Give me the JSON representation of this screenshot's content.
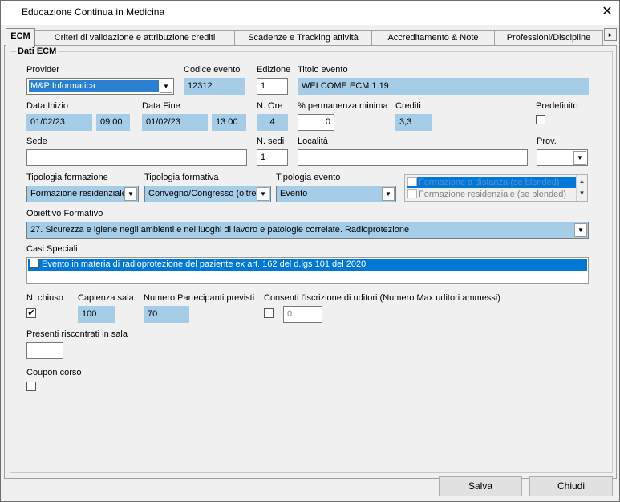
{
  "window": {
    "title": "Educazione Continua in Medicina",
    "close_glyph": "✕"
  },
  "tabs": [
    {
      "label": "ECM"
    },
    {
      "label": "Criteri di validazione e attribuzione crediti"
    },
    {
      "label": "Scadenze e Tracking attività"
    },
    {
      "label": "Accreditamento & Note"
    },
    {
      "label": "Professioni/Discipline"
    }
  ],
  "tab_scroll_glyph": "▸",
  "group": {
    "title": "Dati ECM"
  },
  "form": {
    "provider": {
      "label": "Provider",
      "value": "M&P Informatica"
    },
    "codice_evento": {
      "label": "Codice evento",
      "value": "12312"
    },
    "edizione": {
      "label": "Edizione",
      "value": "1"
    },
    "titolo_evento": {
      "label": "Titolo evento",
      "value": "WELCOME ECM 1.19"
    },
    "data_inizio": {
      "label": "Data Inizio",
      "date": "01/02/23",
      "time": "09:00"
    },
    "data_fine": {
      "label": "Data Fine",
      "date": "01/02/23",
      "time": "13:00"
    },
    "n_ore": {
      "label": "N. Ore",
      "value": "4"
    },
    "permanenza": {
      "label": "% permanenza minima",
      "value": "0"
    },
    "crediti": {
      "label": "Crediti",
      "value": "3,3"
    },
    "predefinito": {
      "label": "Predefinito",
      "checked": false
    },
    "sede": {
      "label": "Sede",
      "value": ""
    },
    "n_sedi": {
      "label": "N. sedi",
      "value": "1"
    },
    "localita": {
      "label": "Località",
      "value": ""
    },
    "prov": {
      "label": "Prov.",
      "value": ""
    },
    "tipologia_formazione": {
      "label": "Tipologia formazione",
      "value": "Formazione residenziale"
    },
    "tipologia_formativa": {
      "label": "Tipologia formativa",
      "value": "Convegno/Congresso (oltre"
    },
    "tipologia_evento": {
      "label": "Tipologia evento",
      "value": "Evento"
    },
    "blended_options": [
      {
        "label": "Formazione a distanza (se blended)",
        "checked": false,
        "highlighted": true
      },
      {
        "label": "Formazione residenziale (se blended)",
        "checked": false,
        "highlighted": false
      }
    ],
    "obiettivo_formativo": {
      "label": "Obiettivo Formativo",
      "value": "27. Sicurezza e igiene negli ambienti e nei luoghi di lavoro e patologie correlate. Radioprotezione"
    },
    "casi_speciali": {
      "label": "Casi Speciali",
      "items": [
        {
          "label": "Evento in materia di radioprotezione del paziente ex art. 162 del d.lgs 101 del 2020",
          "checked": true,
          "selected": true
        }
      ]
    },
    "n_chiuso": {
      "label": "N. chiuso",
      "checked": true
    },
    "capienza_sala": {
      "label": "Capienza sala",
      "value": "100"
    },
    "numero_partecipanti": {
      "label": "Numero Partecipanti previsti",
      "value": "70"
    },
    "consenti_uditori": {
      "label": "Consenti l'iscrizione di uditori (Numero Max uditori ammessi)",
      "checked": false,
      "value": "0"
    },
    "presenti_riscontrati": {
      "label": "Presenti riscontrati in sala",
      "value": ""
    },
    "coupon_corso": {
      "label": "Coupon corso",
      "checked": false
    }
  },
  "buttons": {
    "save": "Salva",
    "close": "Chiudi"
  },
  "glyphs": {
    "dropdown": "▼",
    "check": "✔",
    "scroll_up": "▲",
    "scroll_down": "▼"
  },
  "colors": {
    "readonly_field": "#a6cde8",
    "selection": "#0078d7"
  }
}
